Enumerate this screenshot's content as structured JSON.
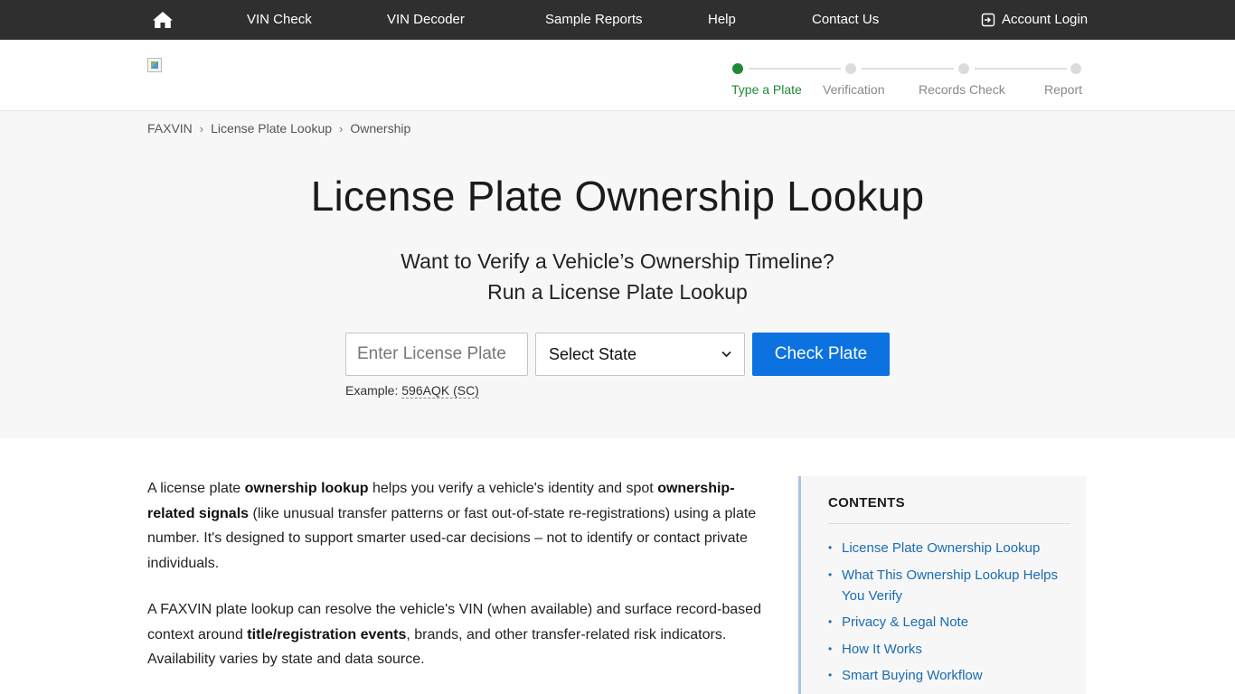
{
  "nav": {
    "items": [
      "VIN Check",
      "VIN Decoder",
      "Sample Reports",
      "Help",
      "Contact Us"
    ],
    "login": "Account Login"
  },
  "steps": [
    "Type a Plate",
    "Verification",
    "Records Check",
    "Report"
  ],
  "colors": {
    "nav_bg": "#2f2f2f",
    "accent_green": "#1e8a36",
    "button_blue": "#0b72e0",
    "link_blue": "#1a6bb0"
  },
  "breadcrumb": [
    "FAXVIN",
    "License Plate Lookup",
    "Ownership"
  ],
  "hero": {
    "title": "License Plate Ownership Lookup",
    "subtitle_1": "Want to Verify a Vehicle’s Ownership Timeline?",
    "subtitle_2": "Run a License Plate Lookup",
    "plate_placeholder": "Enter License Plate",
    "state_value": "Select State",
    "button": "Check Plate",
    "example_label": "Example:",
    "example_value": "596AQK (SC)"
  },
  "body": {
    "p1": {
      "t1": "A license plate ",
      "b1": "ownership lookup",
      "t2": " helps you verify a vehicle's identity and spot ",
      "b2": "ownership-related signals",
      "t3": " (like unusual transfer patterns or fast out-of-state re-registrations) using a plate number. It's designed to support smarter used-car decisions – not to identify or contact private individuals."
    },
    "p2": {
      "t1": "A FAXVIN plate lookup can resolve the vehicle's VIN (when available) and surface record-based context around ",
      "b1": "title/registration events",
      "t2": ", brands, and other transfer-related risk indicators. Availability varies by state and data source."
    }
  },
  "toc": {
    "title": "CONTENTS",
    "items": [
      "License Plate Ownership Lookup",
      "What This Ownership Lookup Helps You Verify",
      "Privacy & Legal Note",
      "How It Works",
      "Smart Buying Workflow"
    ]
  }
}
